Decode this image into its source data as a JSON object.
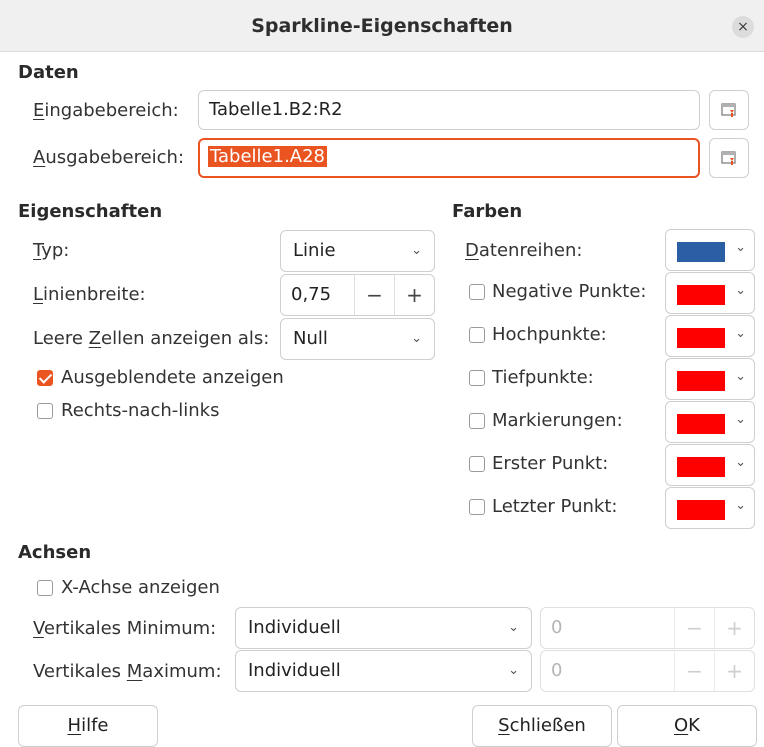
{
  "window": {
    "title": "Sparkline-Eigenschaften",
    "close_glyph": "×"
  },
  "daten": {
    "heading": "Daten",
    "input_range": {
      "mnemonic": "E",
      "label_rest": "ingabebereich:",
      "value": "Tabelle1.B2:R2"
    },
    "output_range": {
      "mnemonic": "A",
      "label_rest": "usgabebereich:",
      "value": "Tabelle1.A28"
    }
  },
  "eigenschaften": {
    "heading": "Eigenschaften",
    "typ": {
      "mnemonic": "T",
      "label_rest": "yp:",
      "value": "Linie"
    },
    "linienbreite": {
      "mnemonic": "L",
      "label_rest": "inienbreite:",
      "value": "0,75",
      "minus": "−",
      "plus": "+"
    },
    "leere_zellen": {
      "label_pre": "Leere ",
      "mnemonic": "Z",
      "label_rest": "ellen anzeigen als:",
      "value": "Null"
    },
    "ausgeblendete": {
      "label": "Ausgeblendete anzeigen",
      "checked": true
    },
    "rtl": {
      "label": "Rechts-nach-links",
      "checked": false
    }
  },
  "farben": {
    "heading": "Farben",
    "datenreihen": {
      "mnemonic": "D",
      "label_rest": "atenreihen:",
      "color": "#2b5fa5"
    },
    "items": [
      {
        "label": "Negative Punkte:",
        "color": "#ff0000",
        "checked": false
      },
      {
        "label": "Hochpunkte:",
        "color": "#ff0000",
        "checked": false
      },
      {
        "label": "Tiefpunkte:",
        "color": "#ff0000",
        "checked": false
      },
      {
        "label": "Markierungen:",
        "color": "#ff0000",
        "checked": false
      },
      {
        "label": "Erster Punkt:",
        "color": "#ff0000",
        "checked": false
      },
      {
        "label": "Letzter Punkt:",
        "color": "#ff0000",
        "checked": false
      }
    ]
  },
  "achsen": {
    "heading": "Achsen",
    "x_achse": {
      "label": "X-Achse anzeigen",
      "checked": false
    },
    "v_min": {
      "mnemonic": "V",
      "label_rest": "ertikales Minimum:",
      "combo": "Individuell",
      "value": "0",
      "minus": "−",
      "plus": "+"
    },
    "v_max": {
      "label_pre": "Vertikales ",
      "mnemonic": "M",
      "label_rest": "aximum:",
      "combo": "Individuell",
      "value": "0",
      "minus": "−",
      "plus": "+"
    }
  },
  "buttons": {
    "hilfe": {
      "mnemonic": "H",
      "label_rest": "ilfe"
    },
    "schliessen": {
      "mnemonic": "S",
      "label_rest": "chließen"
    },
    "ok": {
      "mnemonic": "O",
      "label_rest": "K"
    }
  },
  "icons": {
    "chevron": "⌄",
    "checkmark": "✓"
  }
}
